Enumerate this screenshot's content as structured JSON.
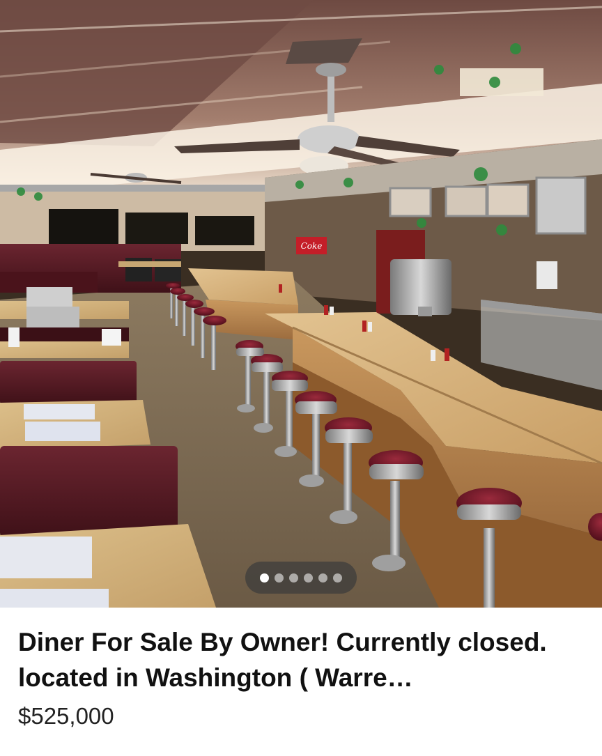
{
  "listing": {
    "title": "Diner For Sale By Owner!  Currently closed.  located in Washington ( Warre…",
    "price": "$525,000"
  },
  "photo": {
    "subject": "diner-interior-photo",
    "signage": {
      "cola_sign": "Coke"
    }
  },
  "carousel": {
    "total_photos": 6,
    "active_index": 0
  },
  "colors": {
    "counter_top": "#d6b27c",
    "stool_seat": "#6a1626",
    "booth": "#5a1e26",
    "ceiling": "#7a5a50"
  }
}
